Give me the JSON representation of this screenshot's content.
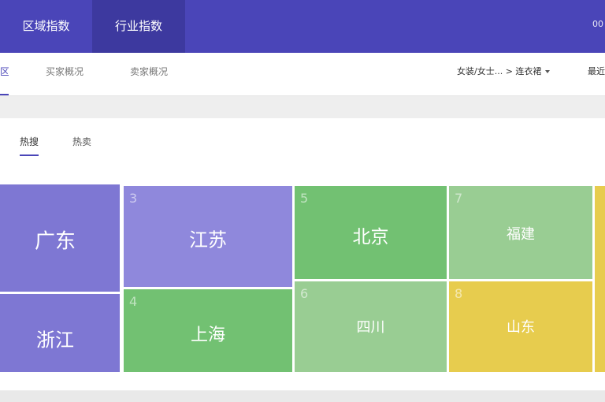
{
  "top_nav": {
    "items": [
      {
        "label": "区域指数",
        "active": false
      },
      {
        "label": "行业指数",
        "active": true
      }
    ],
    "right_text": "00"
  },
  "sub_nav": {
    "tabs": [
      {
        "label": "区",
        "active": true
      },
      {
        "label": "买家概况",
        "active": false
      },
      {
        "label": "卖家概况",
        "active": false
      }
    ],
    "filter_label": "女装/女士... > 连衣裙",
    "right_label": "最近"
  },
  "panel": {
    "tabs": [
      {
        "label": "热搜",
        "active": true
      },
      {
        "label": "热卖",
        "active": false
      }
    ]
  },
  "treemap": {
    "cells": [
      {
        "rank": "",
        "name": "广东",
        "color": "#7e77d3"
      },
      {
        "rank": "",
        "name": "浙江",
        "color": "#7e77d3"
      },
      {
        "rank": "3",
        "name": "江苏",
        "color": "#8f88dc"
      },
      {
        "rank": "4",
        "name": "上海",
        "color": "#72c172"
      },
      {
        "rank": "5",
        "name": "北京",
        "color": "#72c172"
      },
      {
        "rank": "6",
        "name": "四川",
        "color": "#99cd93"
      },
      {
        "rank": "7",
        "name": "福建",
        "color": "#99cd93"
      },
      {
        "rank": "8",
        "name": "山东",
        "color": "#e7cc4e"
      },
      {
        "rank": "",
        "name": "",
        "color": "#e7cc4e"
      }
    ]
  },
  "colors": {
    "brand": "#4a45b8",
    "brand_dark": "#3d399f"
  }
}
